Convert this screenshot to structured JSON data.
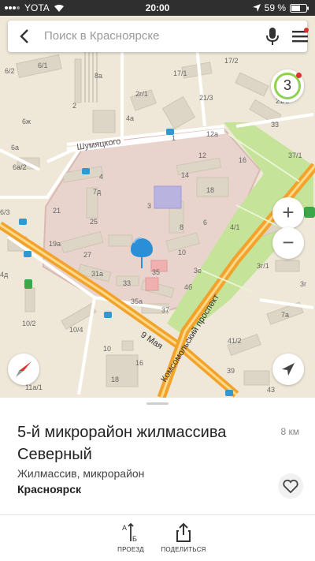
{
  "status_bar": {
    "carrier": "YOTA",
    "time": "20:00",
    "battery": "59 %"
  },
  "search": {
    "placeholder": "Поиск в Красноярске"
  },
  "traffic_level": "3",
  "zoom": {
    "in": "+",
    "out": "−"
  },
  "map": {
    "streets": [
      "Шумяцкого",
      "9 Мая",
      "Комсомольский проспект"
    ],
    "buildings": [
      "6/2",
      "6/1",
      "8а",
      "17/1",
      "17/2",
      "2г/1",
      "21/3",
      "21/2",
      "2",
      "6ж",
      "6а",
      "4а",
      "1",
      "12а",
      "33",
      "37/1",
      "6а/2",
      "7д",
      "14",
      "12",
      "16",
      "18",
      "3",
      "4",
      "6",
      "4/1",
      "6/3",
      "21",
      "25",
      "8",
      "19а",
      "27",
      "10",
      "3г/1",
      "4д",
      "31а",
      "33",
      "35",
      "3г",
      "35а",
      "37",
      "7а",
      "10/2",
      "10/4",
      "10",
      "41/2",
      "39",
      "16",
      "18",
      "11а/1",
      "43",
      "3е",
      "4б",
      "25"
    ]
  },
  "colors": {
    "accent": "#2a8fd6",
    "road": "#f2a32b",
    "park": "#c6e39a",
    "selection": "#e3c9c5"
  },
  "place": {
    "name": "5-й микрорайон жилмассива Северный",
    "type": "Жилмассив, микрорайон",
    "city": "Красноярск",
    "distance": "8 км"
  },
  "actions": {
    "route": "ПРОЕЗД",
    "share": "ПОДЕЛИТЬСЯ"
  }
}
